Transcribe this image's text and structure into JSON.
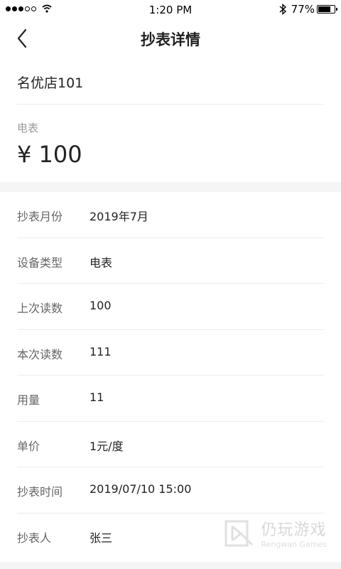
{
  "status_bar": {
    "time": "1:20 PM",
    "battery_percent": "77%",
    "battery_level": 0.77
  },
  "header": {
    "title": "抄表详情",
    "back_icon": "chevron-left-icon"
  },
  "summary": {
    "store_name": "名优店101",
    "meter_type": "电表",
    "amount": "¥ 100"
  },
  "details": [
    {
      "label": "抄表月份",
      "value": "2019年7月"
    },
    {
      "label": "设备类型",
      "value": "电表"
    },
    {
      "label": "上次读数",
      "value": "100"
    },
    {
      "label": "本次读数",
      "value": "111"
    },
    {
      "label": "用量",
      "value": "11"
    },
    {
      "label": "单价",
      "value": "1元/度"
    },
    {
      "label": "抄表时间",
      "value": "2019/07/10 15:00"
    },
    {
      "label": "抄表人",
      "value": "张三"
    }
  ],
  "watermark": {
    "cn": "仍玩游戏",
    "en": "Rengwan Games"
  }
}
